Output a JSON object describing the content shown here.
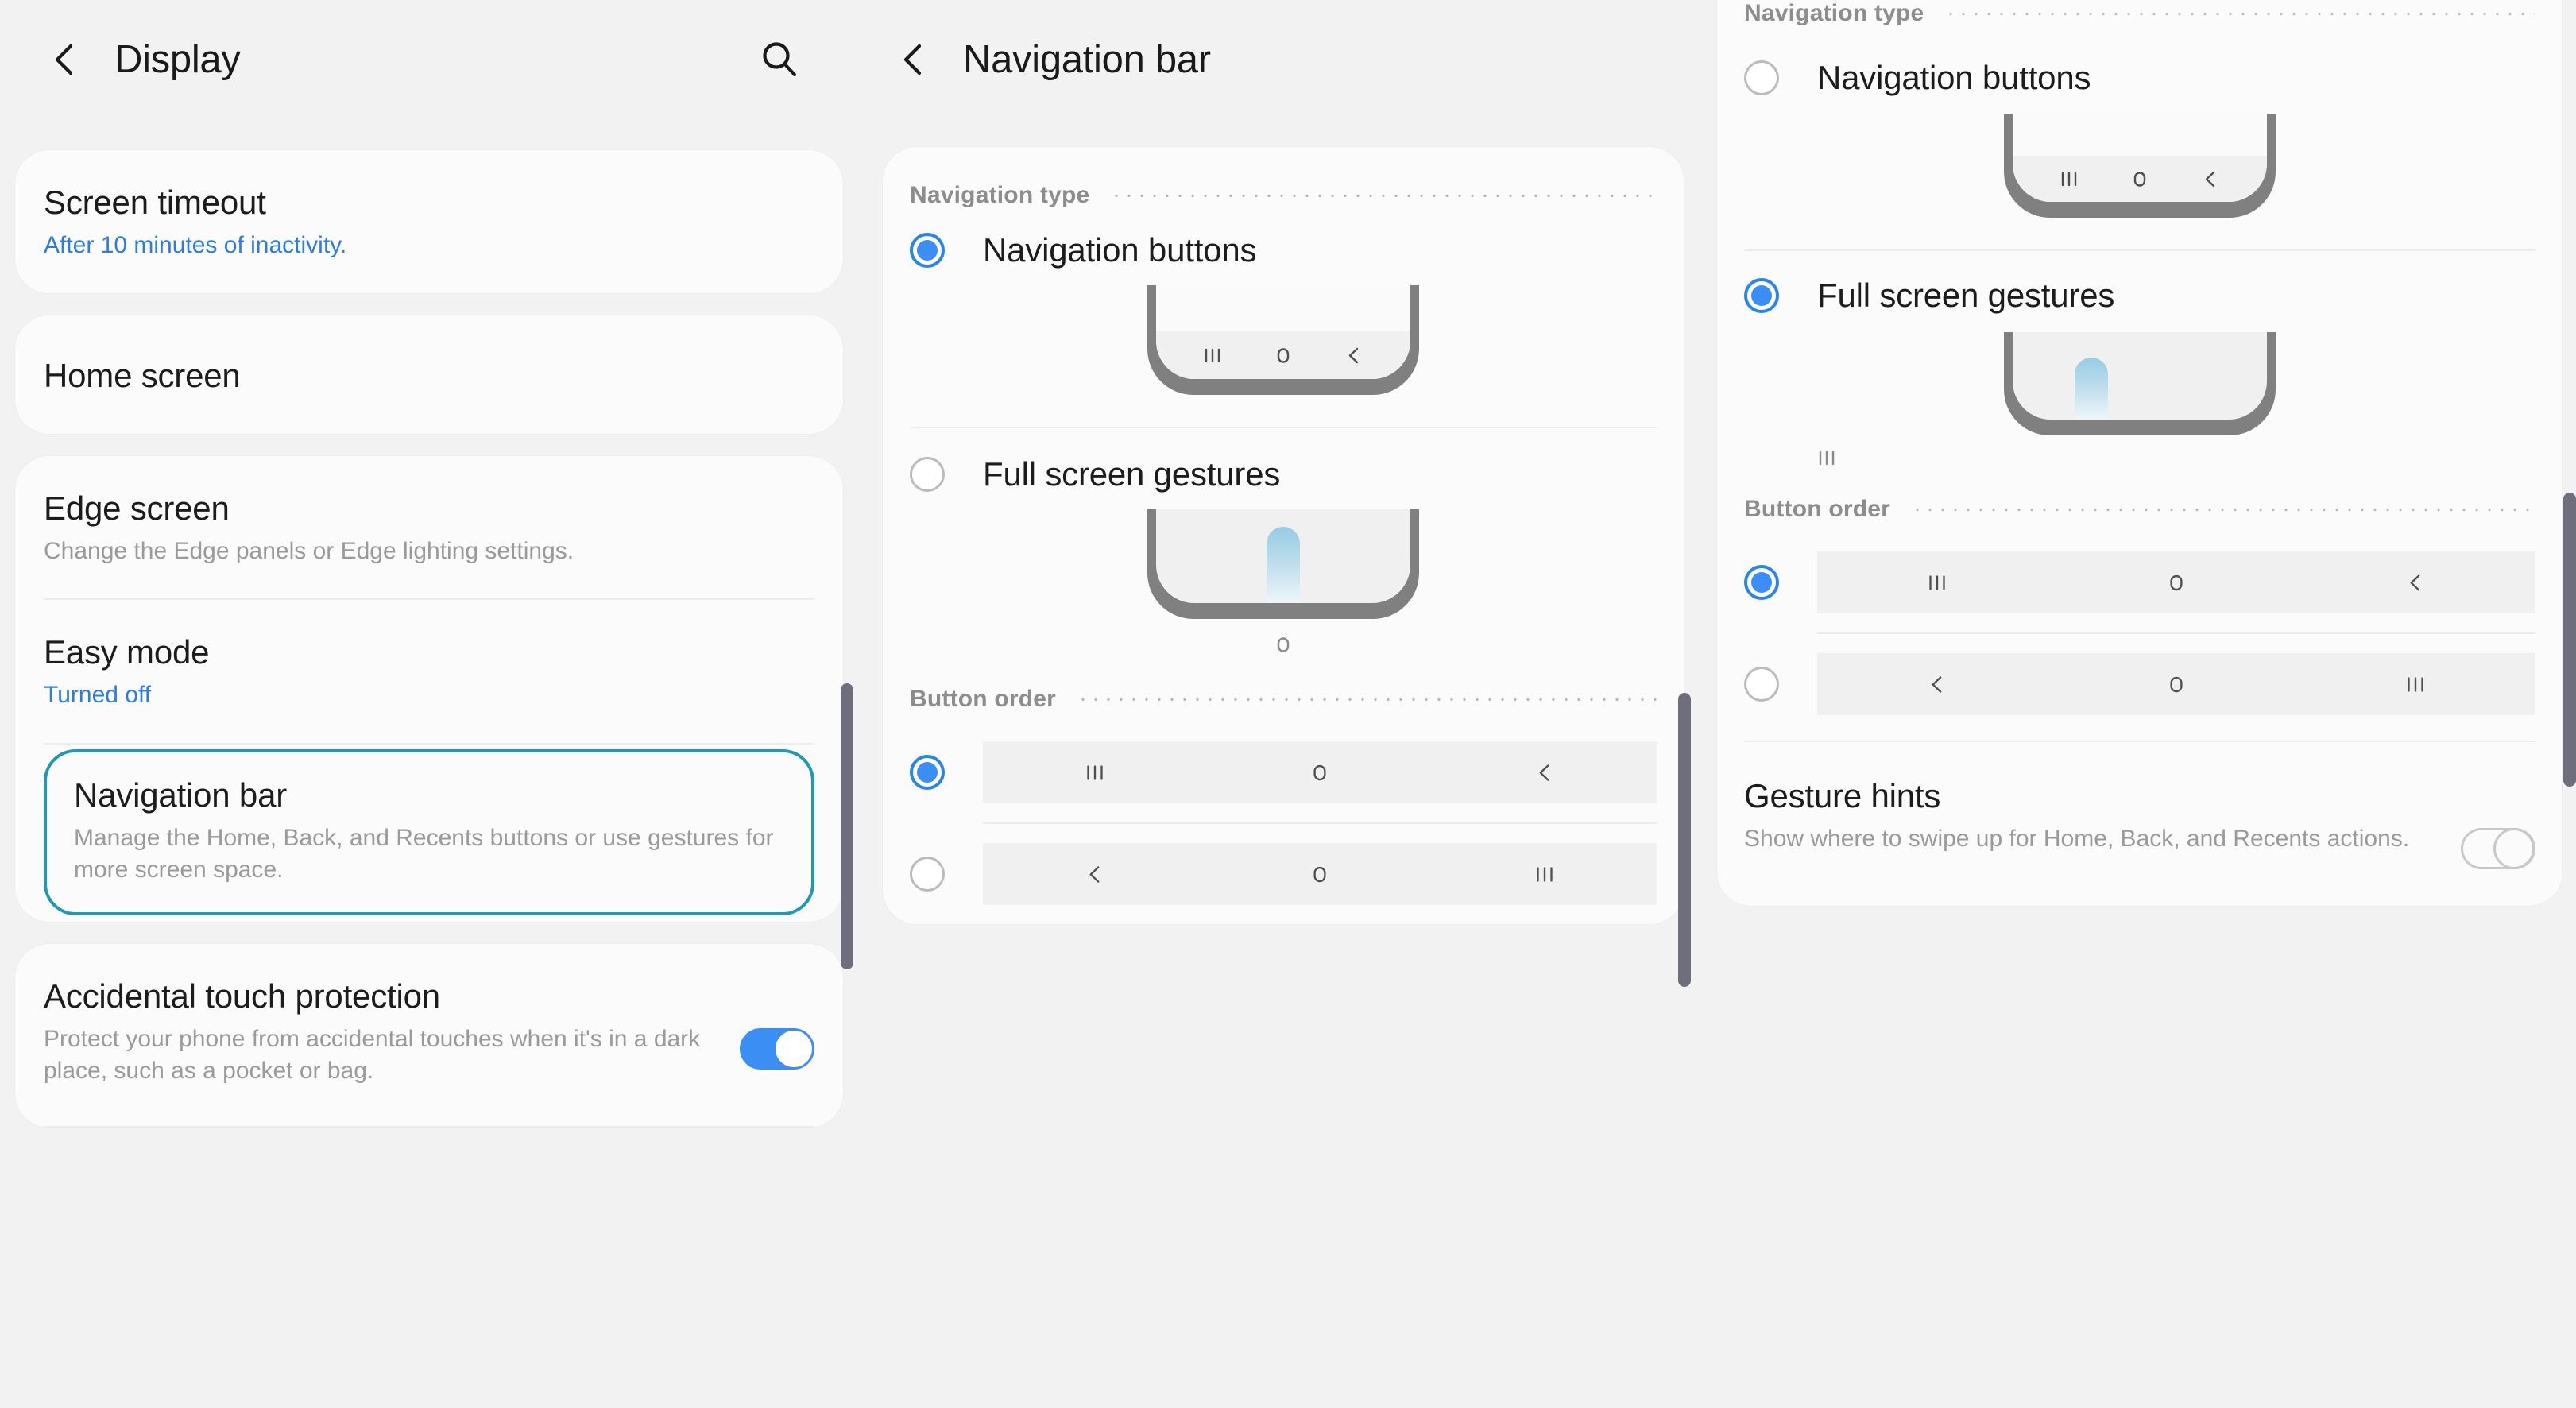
{
  "accent": {
    "blue": "#3b8ef3",
    "link_blue": "#2b7de0",
    "highlight_teal": "#1e9ab5",
    "phone_shell_gray": "#808080",
    "gesture_pill_blue": "#96cce4"
  },
  "display_screen": {
    "back_icon": "chevron-left-icon",
    "title": "Display",
    "search_icon": "search-icon",
    "items": [
      {
        "title": "Screen timeout",
        "subtitle": "After 10 minutes of inactivity.",
        "subtitle_style": "blue"
      },
      {
        "title": "Home screen",
        "subtitle": "",
        "subtitle_style": "none"
      },
      {
        "title": "Edge screen",
        "subtitle": "Change the Edge panels or Edge lighting settings.",
        "subtitle_style": "gray"
      },
      {
        "title": "Easy mode",
        "subtitle": "Turned off",
        "subtitle_style": "blue"
      },
      {
        "title": "Navigation bar",
        "subtitle": "Manage the Home, Back, and Recents buttons or use gestures for more screen space.",
        "subtitle_style": "gray",
        "highlighted": true
      },
      {
        "title": "Accidental touch protection",
        "subtitle": "Protect your phone from accidental touches when it's in a dark place, such as a pocket or bag.",
        "subtitle_style": "gray",
        "toggle": "on"
      }
    ]
  },
  "nav_bar_screen": {
    "back_icon": "chevron-left-icon",
    "title": "Navigation bar",
    "navigation_type": {
      "label": "Navigation type",
      "options": [
        {
          "label": "Navigation buttons",
          "selected": true,
          "preview": "buttons"
        },
        {
          "label": "Full screen gestures",
          "selected": false,
          "preview": "gestures"
        }
      ]
    },
    "button_order": {
      "label": "Button order",
      "options": [
        {
          "glyphs": [
            "recents-icon",
            "home-icon",
            "back-icon"
          ],
          "selected": true
        },
        {
          "glyphs": [
            "back-icon",
            "home-icon",
            "recents-icon"
          ],
          "selected": false
        }
      ]
    }
  },
  "nav_bar_screen_scrolled": {
    "navigation_type": {
      "label": "Navigation type",
      "options": [
        {
          "label": "Navigation buttons",
          "selected": false,
          "preview": "buttons"
        },
        {
          "label": "Full screen gestures",
          "selected": true,
          "preview": "gestures"
        }
      ]
    },
    "button_order": {
      "label": "Button order",
      "options": [
        {
          "glyphs": [
            "recents-icon",
            "home-icon",
            "back-icon"
          ],
          "selected": true
        },
        {
          "glyphs": [
            "back-icon",
            "home-icon",
            "recents-icon"
          ],
          "selected": false
        }
      ]
    },
    "gesture_hints": {
      "title": "Gesture hints",
      "subtitle": "Show where to swipe up for Home, Back, and Recents actions.",
      "toggle": "off"
    }
  }
}
